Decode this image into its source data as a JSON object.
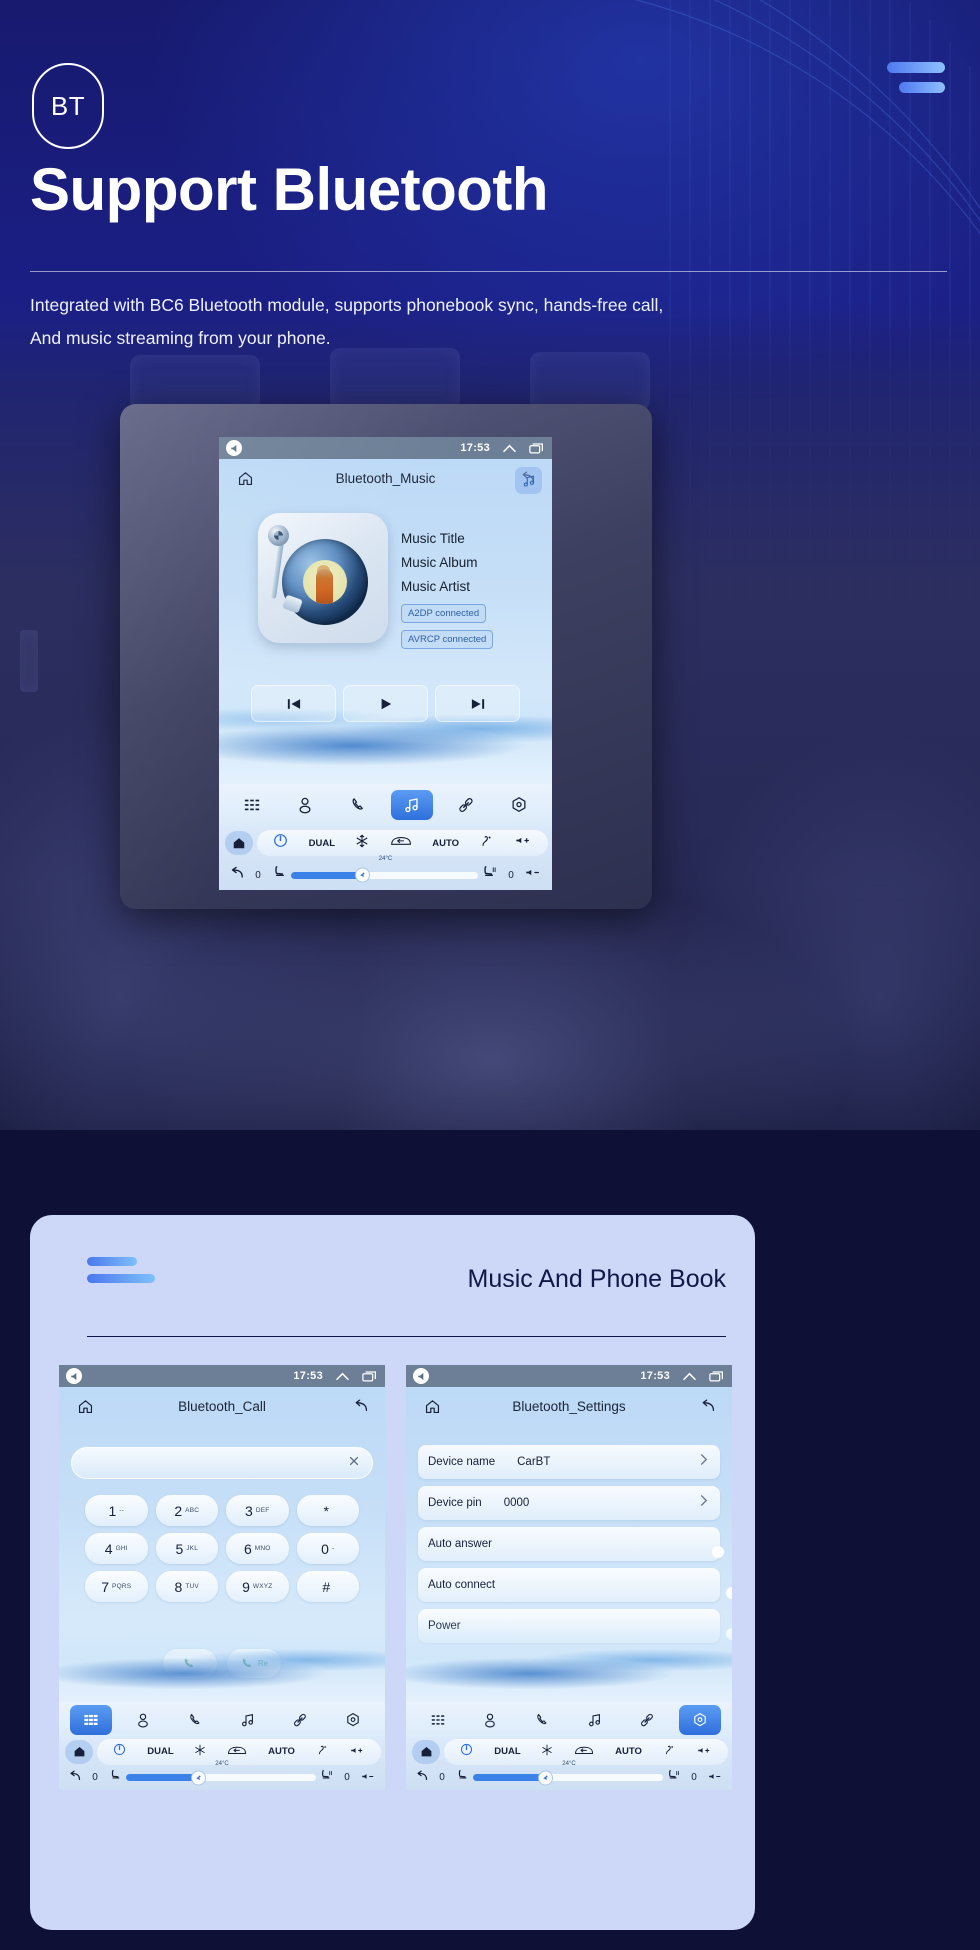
{
  "hero": {
    "badge": "BT",
    "title": "Support Bluetooth",
    "subtitle_line1": "Integrated with BC6 Bluetooth module, supports phonebook sync, hands-free call,",
    "subtitle_line2": "And music streaming from your phone.",
    "menu_icon": "hamburger-menu-icon"
  },
  "colors": {
    "brand_blue": "#2f6fdc",
    "accent_light": "#7ec0fb",
    "hero_bg": "#1b1f86",
    "card_bg": "#cdd8f8",
    "screen_bg": "#bcd6f2",
    "statusbar": "#6c7f96"
  },
  "music_screen": {
    "status": {
      "time": "17:53",
      "back_icon": "volume-back-icon",
      "up_icon": "chevron-up-icon",
      "recents_icon": "recents-icon"
    },
    "home_icon": "home-icon",
    "title": "Bluetooth_Music",
    "back_icon": "back-arrow-icon",
    "badge_icon": "music-note-icon",
    "meta": [
      "Music Title",
      "Music Album",
      "Music Artist"
    ],
    "chips": [
      "A2DP  connected",
      "AVRCP connected"
    ],
    "transport": [
      {
        "name": "previous-track-button",
        "icon": "skip-previous-icon"
      },
      {
        "name": "play-button",
        "icon": "play-icon"
      },
      {
        "name": "next-track-button",
        "icon": "skip-next-icon"
      }
    ],
    "nav": [
      {
        "name": "nav-keypad",
        "icon": "keypad-icon",
        "active": false
      },
      {
        "name": "nav-contacts",
        "icon": "contact-icon",
        "active": false
      },
      {
        "name": "nav-phone",
        "icon": "phone-icon",
        "active": false
      },
      {
        "name": "nav-music",
        "icon": "music-note-icon",
        "active": true
      },
      {
        "name": "nav-link",
        "icon": "link-icon",
        "active": false
      },
      {
        "name": "nav-settings",
        "icon": "settings-gear-icon",
        "active": false
      }
    ],
    "hvac": {
      "home_icon": "home-icon",
      "power_icon": "power-icon",
      "dual": "DUAL",
      "snow_icon": "snowflake-icon",
      "defrost_icon": "rear-defrost-icon",
      "auto": "AUTO",
      "air_icon": "airflow-icon",
      "vol_up_icon": "volume-up-icon",
      "temp": "24°C",
      "back_icon": "back-arrow-icon",
      "left_value": "0",
      "right_value": "0",
      "seat_left_icon": "seat-heat-icon",
      "seat_right_icon": "seat-heat-icon",
      "fan_icon": "fan-icon",
      "vol_down_icon": "volume-down-icon"
    }
  },
  "card": {
    "title": "Music And Phone Book"
  },
  "call_screen": {
    "status": {
      "time": "17:53"
    },
    "title": "Bluetooth_Call",
    "input_value": "",
    "clear_icon": "clear-x-icon",
    "keys": [
      {
        "digit": "1",
        "letters": "--"
      },
      {
        "digit": "2",
        "letters": "ABC"
      },
      {
        "digit": "3",
        "letters": "DEF"
      },
      {
        "digit": "*",
        "letters": ""
      },
      {
        "digit": "4",
        "letters": "GHI"
      },
      {
        "digit": "5",
        "letters": "JKL"
      },
      {
        "digit": "6",
        "letters": "MNO"
      },
      {
        "digit": "0",
        "letters": "-"
      },
      {
        "digit": "7",
        "letters": "PQRS"
      },
      {
        "digit": "8",
        "letters": "TUV"
      },
      {
        "digit": "9",
        "letters": "WXYZ"
      },
      {
        "digit": "#",
        "letters": ""
      }
    ],
    "call_button": {
      "name": "call-button",
      "icon": "phone-icon"
    },
    "redial_button": {
      "name": "redial-button",
      "icon": "phone-icon",
      "label": "Re"
    },
    "nav_active": "nav-keypad"
  },
  "settings_screen": {
    "status": {
      "time": "17:53"
    },
    "title": "Bluetooth_Settings",
    "rows": [
      {
        "label": "Device name",
        "value": "CarBT",
        "control": "chevron"
      },
      {
        "label": "Device pin",
        "value": "0000",
        "control": "chevron"
      },
      {
        "label": "Auto answer",
        "value": "",
        "control": "toggle",
        "on": false
      },
      {
        "label": "Auto connect",
        "value": "",
        "control": "toggle",
        "on": true
      },
      {
        "label": "Power",
        "value": "",
        "control": "toggle",
        "on": true
      }
    ],
    "nav_active": "nav-settings"
  }
}
